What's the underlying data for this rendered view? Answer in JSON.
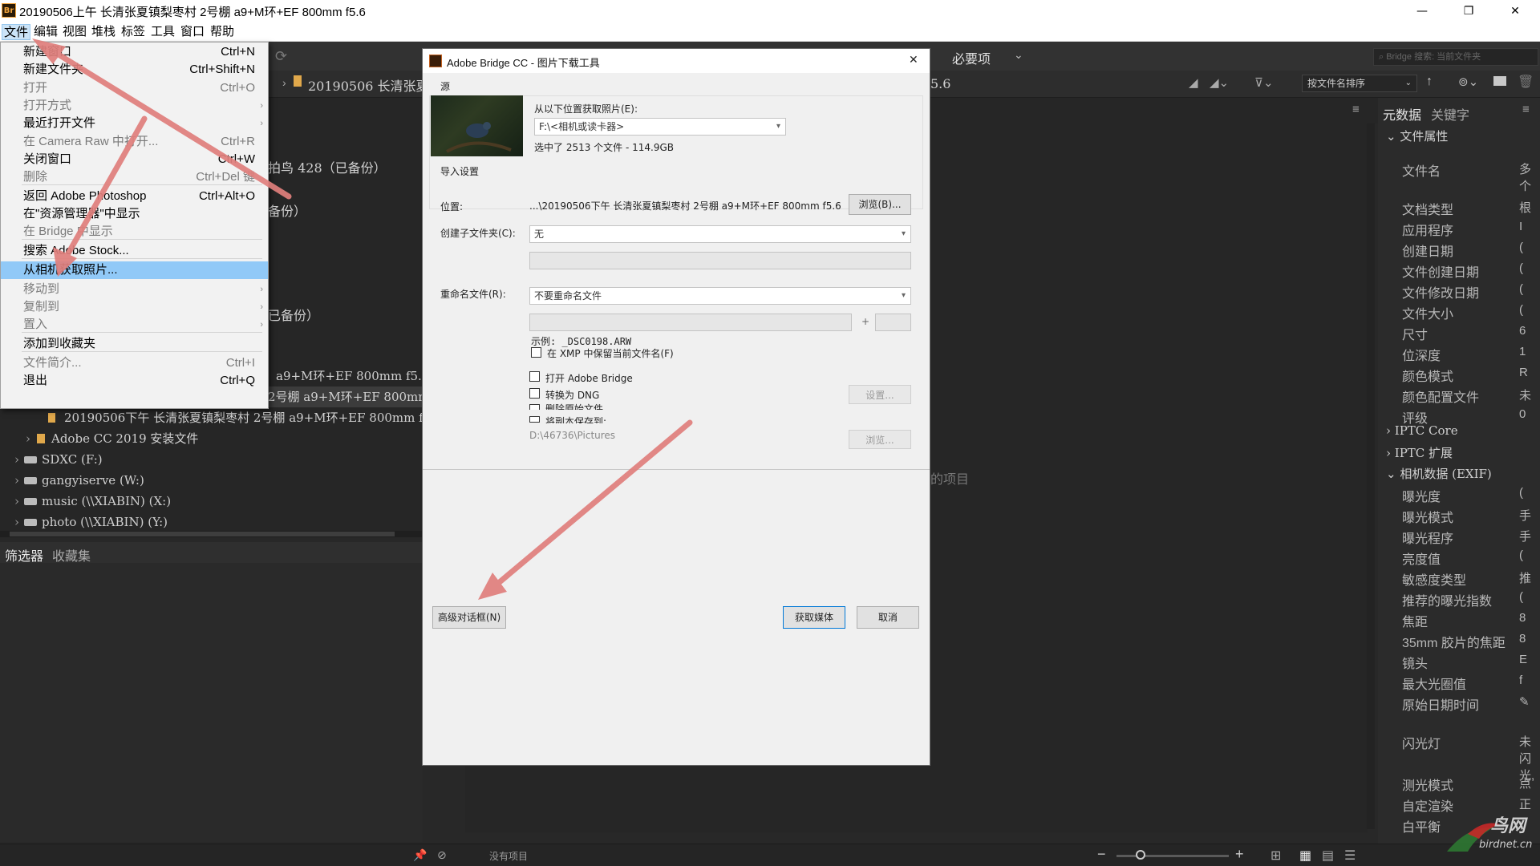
{
  "window": {
    "title": "20190506上午 长清张夏镇梨枣村 2号棚 a9+M环+EF 800mm f5.6",
    "app_icon": "Br",
    "controls": [
      "—",
      "❐",
      "✕"
    ]
  },
  "menubar": [
    "文件",
    "编辑",
    "视图",
    "堆栈",
    "标签",
    "工具",
    "窗口",
    "帮助"
  ],
  "file_menu": [
    {
      "label": "新建窗口",
      "shortcut": "Ctrl+N",
      "enabled": true
    },
    {
      "label": "新建文件夹",
      "shortcut": "Ctrl+Shift+N",
      "enabled": true
    },
    {
      "label": "打开",
      "shortcut": "Ctrl+O",
      "enabled": false
    },
    {
      "label": "打开方式",
      "shortcut": "",
      "enabled": false,
      "submenu": true
    },
    {
      "label": "最近打开文件",
      "shortcut": "",
      "enabled": true,
      "submenu": true
    },
    {
      "label": "在 Camera Raw 中打开...",
      "shortcut": "Ctrl+R",
      "enabled": false
    },
    {
      "label": "关闭窗口",
      "shortcut": "Ctrl+W",
      "enabled": true
    },
    {
      "label": "删除",
      "shortcut": "Ctrl+Del 键",
      "enabled": false
    },
    {
      "label": "返回 Adobe Photoshop",
      "shortcut": "Ctrl+Alt+O",
      "enabled": true
    },
    {
      "label": "在\"资源管理器\"中显示",
      "shortcut": "",
      "enabled": true
    },
    {
      "label": "在 Bridge 中显示",
      "shortcut": "",
      "enabled": false
    },
    {
      "label": "搜索 Adobe Stock...",
      "shortcut": "",
      "enabled": true
    },
    {
      "label": "从相机获取照片...",
      "shortcut": "",
      "enabled": true,
      "highlighted": true
    },
    {
      "label": "移动到",
      "shortcut": "",
      "enabled": false,
      "submenu": true
    },
    {
      "label": "复制到",
      "shortcut": "",
      "enabled": false,
      "submenu": true
    },
    {
      "label": "置入",
      "shortcut": "",
      "enabled": false,
      "submenu": true
    },
    {
      "label": "添加到收藏夹",
      "shortcut": "",
      "enabled": true
    },
    {
      "label": "文件简介...",
      "shortcut": "Ctrl+I",
      "enabled": false
    },
    {
      "label": "退出",
      "shortcut": "Ctrl+Q",
      "enabled": true
    }
  ],
  "toolbar": {
    "workspace": "必要项",
    "search_placeholder": "Bridge 搜索: 当前文件夹",
    "path": "20190506 长清张夏",
    "path_suffix": "5.6",
    "sort": "按文件名排序"
  },
  "tree": {
    "partial_rows": [
      "拍鸟 428（已备份）",
      "备份）",
      "已备份）"
    ],
    "rows": [
      {
        "text": "a9+M环+EF 800mm f5.6 (",
        "selected": false
      },
      {
        "text": "2号棚 a9+M环+EF 800mm f5",
        "selected": true
      },
      {
        "text": "20190506下午 长清张夏镇梨枣村 2号棚 a9+M环+EF 800mm f5",
        "selected": false
      },
      {
        "text": "Adobe CC 2019 安装文件",
        "selected": false
      },
      {
        "text": "SDXC (F:)",
        "selected": false
      },
      {
        "text": "gangyiserve (W:)",
        "selected": false
      },
      {
        "text": "music (\\\\XIABIN) (X:)",
        "selected": false
      },
      {
        "text": "photo (\\\\XIABIN) (Y:)",
        "selected": false
      }
    ]
  },
  "bottom_tabs": [
    "筛选器",
    "收藏集"
  ],
  "content_partial": "的项目",
  "status": {
    "no_items": "没有项目"
  },
  "metadata_panel": {
    "tabs": [
      "元数据",
      "关键字"
    ],
    "file_props_header": "文件属性",
    "file_props": [
      {
        "label": "文件名",
        "value": "多个"
      },
      {
        "label": "文档类型",
        "value": "根"
      },
      {
        "label": "应用程序",
        "value": "I"
      },
      {
        "label": "创建日期",
        "value": "("
      },
      {
        "label": "文件创建日期",
        "value": "("
      },
      {
        "label": "文件修改日期",
        "value": "("
      },
      {
        "label": "文件大小",
        "value": "("
      },
      {
        "label": "尺寸",
        "value": "6"
      },
      {
        "label": "位深度",
        "value": "1"
      },
      {
        "label": "颜色模式",
        "value": "R"
      },
      {
        "label": "颜色配置文件",
        "value": "未"
      },
      {
        "label": "评级",
        "value": "0"
      }
    ],
    "sections": [
      "IPTC Core",
      "IPTC 扩展",
      "相机数据 (EXIF)"
    ],
    "exif": [
      {
        "label": "曝光度",
        "value": "("
      },
      {
        "label": "曝光模式",
        "value": "手"
      },
      {
        "label": "曝光程序",
        "value": "手"
      },
      {
        "label": "亮度值",
        "value": "("
      },
      {
        "label": "敏感度类型",
        "value": "推"
      },
      {
        "label": "推荐的曝光指数",
        "value": "("
      },
      {
        "label": "焦距",
        "value": "8"
      },
      {
        "label": "35mm 胶片的焦距",
        "value": "8"
      },
      {
        "label": "镜头",
        "value": "E"
      },
      {
        "label": "最大光圈值",
        "value": "f"
      },
      {
        "label": "原始日期时间",
        "value": "✎"
      },
      {
        "label": "闪光灯",
        "value": "未闪光,"
      },
      {
        "label": "测光模式",
        "value": "点"
      },
      {
        "label": "自定渲染",
        "value": "正"
      },
      {
        "label": "白平衡",
        "value": ""
      }
    ]
  },
  "dialog": {
    "title": "Adobe Bridge CC - 图片下载工具",
    "close": "✕",
    "source_label": "源",
    "get_from_label": "从以下位置获取照片(E):",
    "get_from_value": "F:\\<相机或读卡器>",
    "selected_info": "选中了 2513 个文件 - 114.9GB",
    "import_settings_label": "导入设置",
    "location_label": "位置:",
    "location_value": "...\\20190506下午 长清张夏镇梨枣村 2号棚 a9+M环+EF 800mm f5.6",
    "browse_button": "浏览(B)...",
    "subfolder_label": "创建子文件夹(C):",
    "subfolder_value": "无",
    "rename_label": "重命名文件(R):",
    "rename_value": "不要重命名文件",
    "plus": "+",
    "example": "示例:  _DSC0198.ARW",
    "preserve_label": "在 XMP 中保留当前文件名(F)",
    "open_bridge_label": "打开 Adobe Bridge",
    "convert_dng_label": "转换为 DNG",
    "settings_button": "设置...",
    "delete_originals_label": "删除原始文件",
    "save_copies_label": "将副本保存到:",
    "copies_path": "D:\\46736\\Pictures",
    "browse2_button": "浏览...",
    "advanced_button": "高级对话框(N)",
    "get_media_button": "获取媒体",
    "cancel_button": "取消"
  },
  "watermark": {
    "text": "鸟网",
    "sub": "birdnet.cn"
  },
  "colors": {
    "arrow": "#e07f7c",
    "highlight": "#91c9f7",
    "accent": "#f2a33a"
  }
}
